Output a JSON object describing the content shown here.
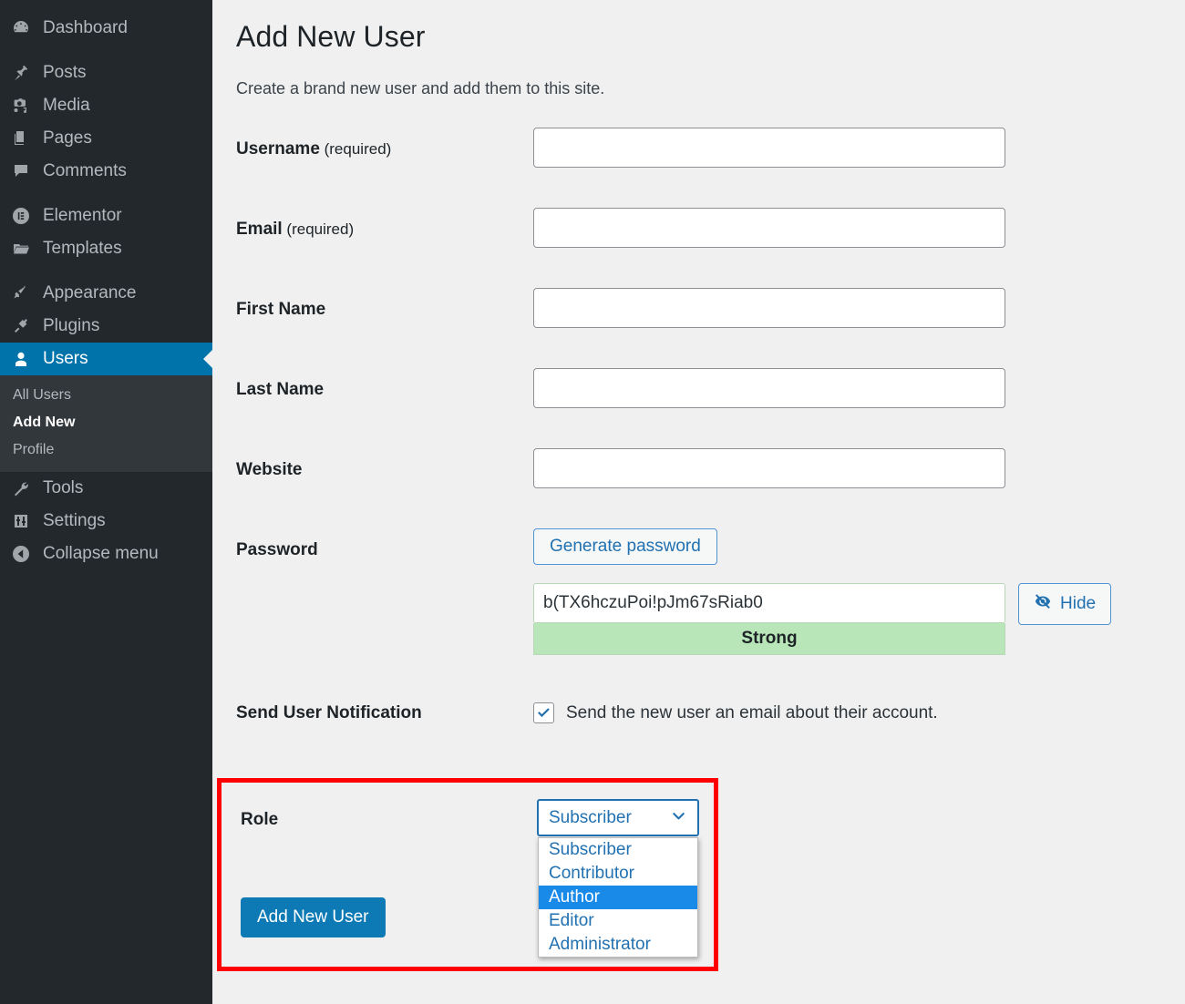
{
  "sidebar": {
    "items": [
      {
        "label": "Dashboard",
        "icon": "dashboard-icon",
        "active": false
      },
      {
        "label": "Posts",
        "icon": "pin-icon",
        "active": false
      },
      {
        "label": "Media",
        "icon": "media-icon",
        "active": false
      },
      {
        "label": "Pages",
        "icon": "pages-icon",
        "active": false
      },
      {
        "label": "Comments",
        "icon": "comments-icon",
        "active": false
      },
      {
        "label": "Elementor",
        "icon": "elementor-icon",
        "active": false
      },
      {
        "label": "Templates",
        "icon": "folder-icon",
        "active": false
      },
      {
        "label": "Appearance",
        "icon": "brush-icon",
        "active": false
      },
      {
        "label": "Plugins",
        "icon": "plug-icon",
        "active": false
      },
      {
        "label": "Users",
        "icon": "user-icon",
        "active": true
      },
      {
        "label": "Tools",
        "icon": "wrench-icon",
        "active": false
      },
      {
        "label": "Settings",
        "icon": "sliders-icon",
        "active": false
      },
      {
        "label": "Collapse menu",
        "icon": "collapse-arrow-icon",
        "active": false
      }
    ],
    "submenu": [
      {
        "label": "All Users",
        "current": false
      },
      {
        "label": "Add New",
        "current": true
      },
      {
        "label": "Profile",
        "current": false
      }
    ]
  },
  "main": {
    "title": "Add New User",
    "subtitle": "Create a brand new user and add them to this site.",
    "fields": [
      {
        "label": "Username",
        "required_note": " (required)",
        "value": "",
        "name": "username-input"
      },
      {
        "label": "Email",
        "required_note": " (required)",
        "value": "",
        "name": "email-input"
      },
      {
        "label": "First Name",
        "required_note": "",
        "value": "",
        "name": "first-name-input"
      },
      {
        "label": "Last Name",
        "required_note": "",
        "value": "",
        "name": "last-name-input"
      },
      {
        "label": "Website",
        "required_note": "",
        "value": "",
        "name": "website-input"
      }
    ],
    "password": {
      "label": "Password",
      "generate_label": "Generate password",
      "value": "b(TX6hczuPoi!pJm67sRiab0",
      "strength": "Strong",
      "hide_label": "Hide",
      "hide_icon": "eye-slash-icon"
    },
    "notification": {
      "label": "Send User Notification",
      "checkbox_label": "Send the new user an email about their account.",
      "checked": true
    },
    "role": {
      "label": "Role",
      "selected": "Subscriber",
      "options": [
        {
          "label": "Subscriber",
          "highlighted": false
        },
        {
          "label": "Contributor",
          "highlighted": false
        },
        {
          "label": "Author",
          "highlighted": true
        },
        {
          "label": "Editor",
          "highlighted": false
        },
        {
          "label": "Administrator",
          "highlighted": false
        }
      ],
      "open": true
    },
    "submit_label": "Add New User"
  },
  "colors": {
    "sidebar_bg": "#23282d",
    "submenu_bg": "#32373c",
    "accent_blue": "#0073aa",
    "highlight_blue": "#1a8ae8",
    "annotation_red": "#ff0000",
    "strength_green": "#b8e6b8",
    "link_blue": "#2271b1"
  }
}
